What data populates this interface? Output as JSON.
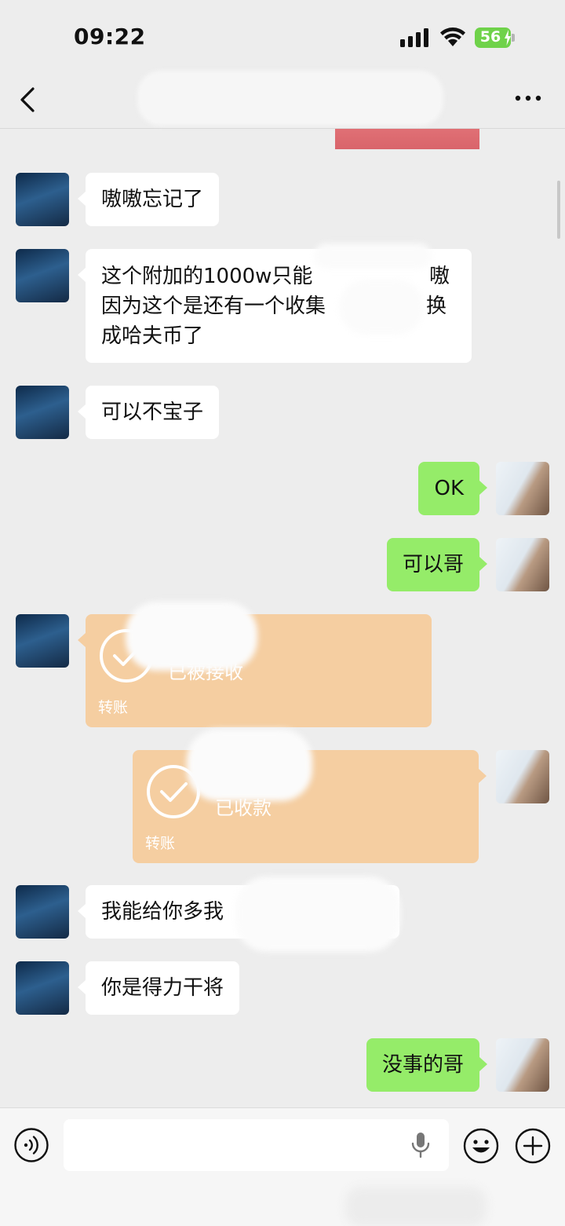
{
  "status_bar": {
    "time": "09:22",
    "battery": "56"
  },
  "nav": {
    "title": ""
  },
  "messages": [
    {
      "side": "left",
      "type": "text",
      "text": "嗷嗷忘记了"
    },
    {
      "side": "left",
      "type": "text",
      "lines": [
        "这个附加的1000w只能",
        "因为这个是还有一个收集",
        "成哈夫币了"
      ],
      "line_ends": [
        "嗷",
        "换",
        ""
      ]
    },
    {
      "side": "left",
      "type": "text",
      "text": "可以不宝子"
    },
    {
      "side": "right",
      "type": "text",
      "text": "OK"
    },
    {
      "side": "right",
      "type": "text",
      "text": "可以哥"
    },
    {
      "side": "left",
      "type": "transfer",
      "status": "已被接收",
      "label": "转账"
    },
    {
      "side": "right",
      "type": "transfer",
      "status": "已收款",
      "label": "转账"
    },
    {
      "side": "left",
      "type": "text",
      "text": "我能给你多我"
    },
    {
      "side": "left",
      "type": "text",
      "text": "你是得力干将"
    },
    {
      "side": "right",
      "type": "text",
      "text": "没事的哥"
    }
  ],
  "input_bar": {
    "placeholder": ""
  },
  "colors": {
    "self_bubble": "#95ec69",
    "other_bubble": "#ffffff",
    "transfer": "#f5cea1",
    "background": "#ededed"
  }
}
